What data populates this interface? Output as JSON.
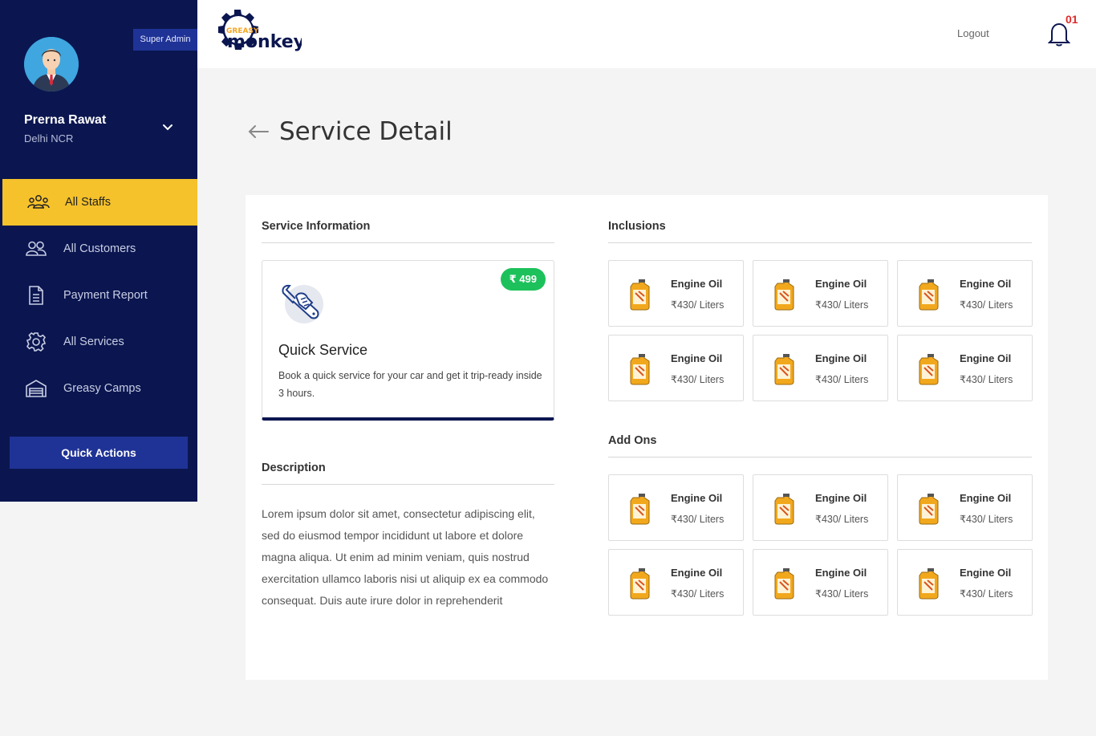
{
  "user": {
    "role": "Super Admin",
    "name": "Prerna Rawat",
    "location": "Delhi NCR"
  },
  "nav": {
    "items": [
      {
        "label": "All Staffs",
        "icon": "staff-group-icon",
        "active": true
      },
      {
        "label": "All Customers",
        "icon": "customers-icon",
        "active": false
      },
      {
        "label": "Payment Report",
        "icon": "report-document-icon",
        "active": false
      },
      {
        "label": "All Services",
        "icon": "gear-icon",
        "active": false
      },
      {
        "label": "Greasy Camps",
        "icon": "garage-icon",
        "active": false
      }
    ],
    "quick_actions": "Quick Actions"
  },
  "header": {
    "logo_text_top": "GREASY",
    "logo_text_main": "monkey",
    "logout": "Logout",
    "notification_count": "01"
  },
  "page": {
    "title": "Service Detail"
  },
  "service": {
    "section_title": "Service Information",
    "price": "499",
    "price_icon": "rupee-icon",
    "name": "Quick Service",
    "desc": "Book a quick service for your car and get it trip-ready inside 3 hours."
  },
  "description": {
    "section_title": "Description",
    "text": "Lorem ipsum dolor sit amet, consectetur adipiscing elit, sed do eiusmod tempor incididunt ut labore et dolore magna aliqua. Ut enim ad minim veniam, quis nostrud exercitation ullamco laboris nisi ut aliquip ex ea commodo consequat. Duis aute irure dolor in reprehenderit"
  },
  "inclusions": {
    "section_title": "Inclusions",
    "items": [
      {
        "name": "Engine Oil",
        "price": "430/ Liters"
      },
      {
        "name": "Engine Oil",
        "price": "430/ Liters"
      },
      {
        "name": "Engine Oil",
        "price": "430/ Liters"
      },
      {
        "name": "Engine Oil",
        "price": "430/ Liters"
      },
      {
        "name": "Engine Oil",
        "price": "430/ Liters"
      },
      {
        "name": "Engine Oil",
        "price": "430/ Liters"
      }
    ]
  },
  "addons": {
    "section_title": "Add Ons",
    "items": [
      {
        "name": "Engine Oil",
        "price": "430/ Liters"
      },
      {
        "name": "Engine Oil",
        "price": "430/ Liters"
      },
      {
        "name": "Engine Oil",
        "price": "430/ Liters"
      },
      {
        "name": "Engine Oil",
        "price": "430/ Liters"
      },
      {
        "name": "Engine Oil",
        "price": "430/ Liters"
      },
      {
        "name": "Engine Oil",
        "price": "430/ Liters"
      }
    ]
  },
  "colors": {
    "sidebar_bg": "#0b1650",
    "accent_yellow": "#f5c22b",
    "badge_blue": "#1f3396",
    "price_green": "#1cc15b",
    "notif_red": "#e02a2a"
  }
}
